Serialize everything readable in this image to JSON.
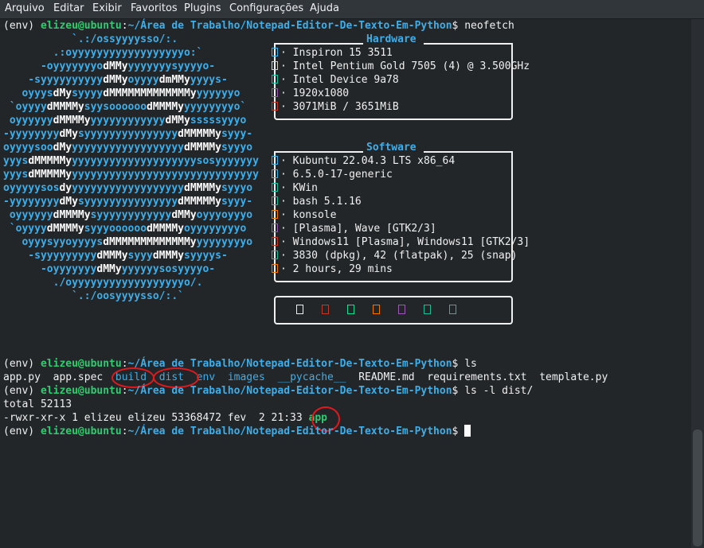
{
  "menu": [
    "Arquivo",
    "Editar",
    "Exibir",
    "Favoritos",
    "Plugins",
    "Configurações",
    "Ajuda"
  ],
  "prompt": {
    "env": "(env) ",
    "user": "elizeu@ubuntu",
    "colon": ":",
    "path": "~/Área de Trabalho/Notepad-Editor-De-Texto-Em-Python",
    "dollar": "$"
  },
  "commands": {
    "c1": " neofetch",
    "c2": " ls",
    "c3": " ls -l dist/"
  },
  "logo": [
    "           `.:/ossyyyysso/:.",
    "        .:oyyyyyyyyyyyyyyyyyyo:`",
    "      -oyyyyyyyo[dMMy]yyyyyyysyyyyo-",
    "    -syyyyyyyyyy[dMMy]oyyyy[dmMMy]yyyys-",
    "   oyyys[dMy]syyyy[dMMMMMMMMMMMMMy]yyyyyyo",
    " `oyyyy[dMMMMy]syysoooooo[dMMMMy]yyyyyyyyo`",
    " oyyyyyy[dMMMMy]yyyyyyyyyyyy[dMMy]sssssyyyo",
    "-yyyyyyyy[dMy]syyyyyyyyyyyyyyy[dMMMMMy]syyy-",
    "oyyyysoo[dMy]yyyyyyyyyyyyyyyyyy[dMMMMy]syyyo",
    "yyys[dMMMMMy]yyyyyyyyyyyyyyyyyyyysosyyyyyyy",
    "yyys[dMMMMMy]yyyyyyyyyyyyyyyyyyyyyyyyyyyyyy",
    "oyyyyysos[dy]yyyyyyyyyyyyyyyyyy[dMMMMy]syyyo",
    "-yyyyyyyy[dMy]syyyyyyyyyyyyyyy[dMMMMMy]syyy-",
    " oyyyyyy[dMMMMy]syyyyyyyyyyyy[dMMy]oyyyoyyyo",
    " `oyyyy[dMMMMy]syyyoooooo[dMMMMy]oyyyyyyyyo",
    "   oyyysyyoyyyys[dMMMMMMMMMMMMMy]yyyyyyyyo",
    "    -syyyyyyyyy[dMMMy]syyy[dMMMy]syyyys-",
    "      -oyyyyyyy[dMMy]yyyyyysosyyyyo-",
    "        ./oyyyyyyyyyyyyyyyyyyo/.",
    "           `.:/oosyyyysso/:.`"
  ],
  "hardware": {
    "title": "Hardware",
    "items": [
      {
        "text": "· Inspiron 15 3511",
        "color": "#3daee9"
      },
      {
        "text": "· Intel Pentium Gold 7505 (4) @ 3.500GHz",
        "color": "#cfcfc2"
      },
      {
        "text": "· Intel Device 9a78",
        "color": "#1abc9c"
      },
      {
        "text": "· 1920x1080",
        "color": "#9b59b6"
      },
      {
        "text": "· 3071MiB / 3651MiB",
        "color": "#c0392b"
      }
    ]
  },
  "software": {
    "title": "Software",
    "items": [
      {
        "text": "· Kubuntu 22.04.3 LTS x86_64",
        "color": "#3daee9"
      },
      {
        "text": "· 6.5.0-17-generic",
        "color": "#3daee9"
      },
      {
        "text": "· KWin",
        "color": "#1abc9c"
      },
      {
        "text": "· bash 5.1.16",
        "color": "#1abc9c"
      },
      {
        "text": "· konsole",
        "color": "#f67400"
      },
      {
        "text": "· [Plasma], Wave [GTK2/3]",
        "color": "#9b59b6"
      },
      {
        "text": "· Windows11 [Plasma], Windows11 [GTK2/3]",
        "color": "#c0392b"
      },
      {
        "text": "· 3830 (dpkg), 42 (flatpak), 25 (snap)",
        "color": "#1abc9c"
      },
      {
        "text": "· 2 hours, 29 mins",
        "color": "#f67400"
      }
    ]
  },
  "palette": [
    "#eff0f1",
    "#c0392b",
    "#1cdc9a",
    "#f67400",
    "#9b59b6",
    "#1abc9c",
    "#7f8c8d"
  ],
  "ls": {
    "f1": "app.py",
    "f2": "app.spec",
    "d1": "build",
    "d2": "dist",
    "d3": "env",
    "d4": "images",
    "d5": "__pycache__",
    "f3": "README.md",
    "f4": "requirements.txt",
    "f5": "template.py"
  },
  "lsl": {
    "total": "total 52113",
    "line": "-rwxr-xr-x 1 elizeu elizeu 53368472 fev  2 21:33 ",
    "app": "app"
  }
}
